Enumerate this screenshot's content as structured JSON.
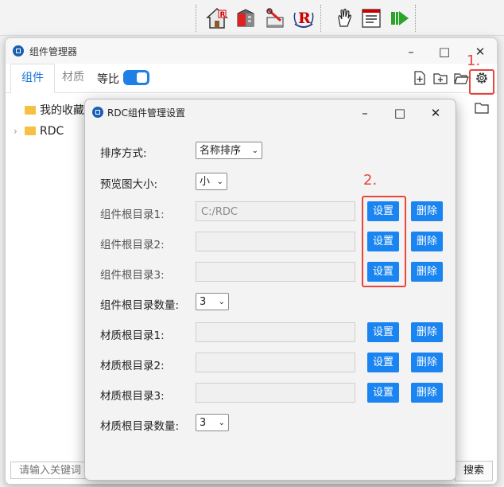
{
  "toolbar": {
    "icons": [
      "house-icon",
      "building-icon",
      "tools-icon",
      "rdc-badge-icon",
      "hand-icon",
      "list-icon",
      "play-icon"
    ]
  },
  "main_window": {
    "title": "组件管理器",
    "tabs": [
      {
        "label": "组件",
        "active": true
      },
      {
        "label": "材质",
        "active": false
      }
    ],
    "ratio_label": "等比",
    "ratio_toggle_on": true,
    "tree": [
      {
        "label": "我的收藏",
        "expandable": false
      },
      {
        "label": "RDC",
        "expandable": true
      }
    ],
    "search_placeholder": "请输入关键词",
    "search_button": "搜索",
    "callout_1": "1."
  },
  "dialog": {
    "title": "RDC组件管理设置",
    "sort_label": "排序方式:",
    "sort_value": "名称排序",
    "preview_label": "预览图大小:",
    "preview_value": "小",
    "component_roots": [
      {
        "label": "组件根目录1:",
        "value": "C:/RDC"
      },
      {
        "label": "组件根目录2:",
        "value": ""
      },
      {
        "label": "组件根目录3:",
        "value": ""
      }
    ],
    "component_count_label": "组件根目录数量:",
    "component_count_value": "3",
    "material_roots": [
      {
        "label": "材质根目录1:",
        "value": ""
      },
      {
        "label": "材质根目录2:",
        "value": ""
      },
      {
        "label": "材质根目录3:",
        "value": ""
      }
    ],
    "material_count_label": "材质根目录数量:",
    "material_count_value": "3",
    "set_label": "设置",
    "delete_label": "删除",
    "callout_2": "2."
  },
  "colors": {
    "accent": "#1a84f0",
    "highlight": "#e8453c"
  }
}
